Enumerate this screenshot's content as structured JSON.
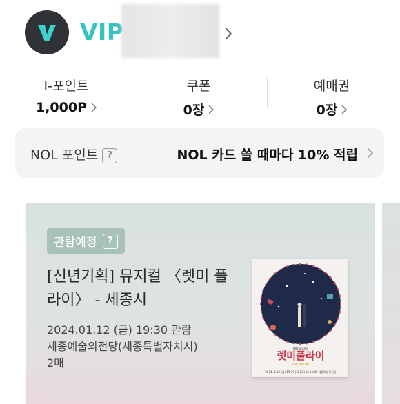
{
  "profile": {
    "tier": "VIP",
    "brand_color": "#34c3c0"
  },
  "stats": [
    {
      "label": "I-포인트",
      "value": "1,000P"
    },
    {
      "label": "쿠폰",
      "value": "0장"
    },
    {
      "label": "예매권",
      "value": "0장"
    }
  ],
  "nol": {
    "label": "NOL 포인트",
    "help": "?",
    "promo": "NOL 카드 쓸 때마다 10% 적립"
  },
  "booking": {
    "status": "관람예정",
    "help": "?",
    "title": "[신년기획] 뮤지컬 〈렛미 플라이〉 - 세종시",
    "datetime": "2024.01.12 (금)  19:30 관람",
    "venue": "세종예술의전당(세종특별자치시)",
    "quantity": "2매",
    "poster": {
      "top_label": "MUSICAL",
      "title": "렛미플라이",
      "subtitle": "Let me fly",
      "dates": "2024. 1.12.(금) 19:30 | 1.13.(토) 15:00  세종예술의전당"
    }
  }
}
